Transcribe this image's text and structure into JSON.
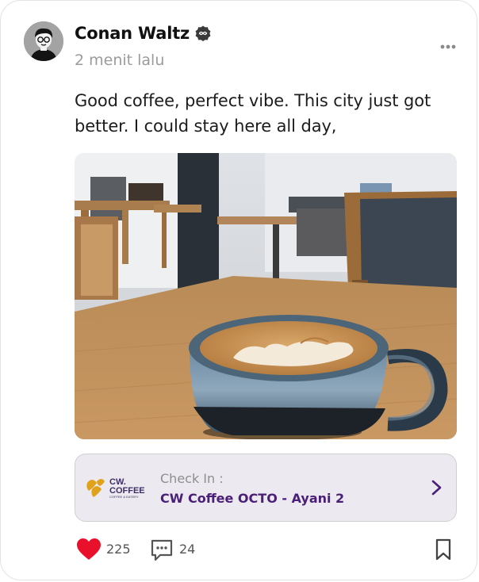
{
  "post": {
    "author": "Conan Waltz",
    "timestamp": "2 menit lalu",
    "caption": "Good coffee, perfect vibe. This city just got better. I could stay here all day,",
    "photo_subject": "latte-art-cup-on-cafe-table"
  },
  "icons": {
    "verified": "verified-badge-icon",
    "more": "more-options-icon",
    "like": "heart-icon",
    "comment": "comment-icon",
    "bookmark": "bookmark-icon",
    "checkin_arrow": "chevron-right-icon"
  },
  "checkin": {
    "label": "Check In :",
    "place": "CW Coffee OCTO - Ayani 2",
    "logo": {
      "line1": "CW.",
      "line2": "COFFEE",
      "line3": "COFFEE & EATERY"
    }
  },
  "actions": {
    "likes": "225",
    "comments": "24"
  },
  "colors": {
    "heart": "#e8102a",
    "place_text": "#4a1f78",
    "checkin_bg": "#ede9f0",
    "logo_gold": "#e0a21c"
  }
}
